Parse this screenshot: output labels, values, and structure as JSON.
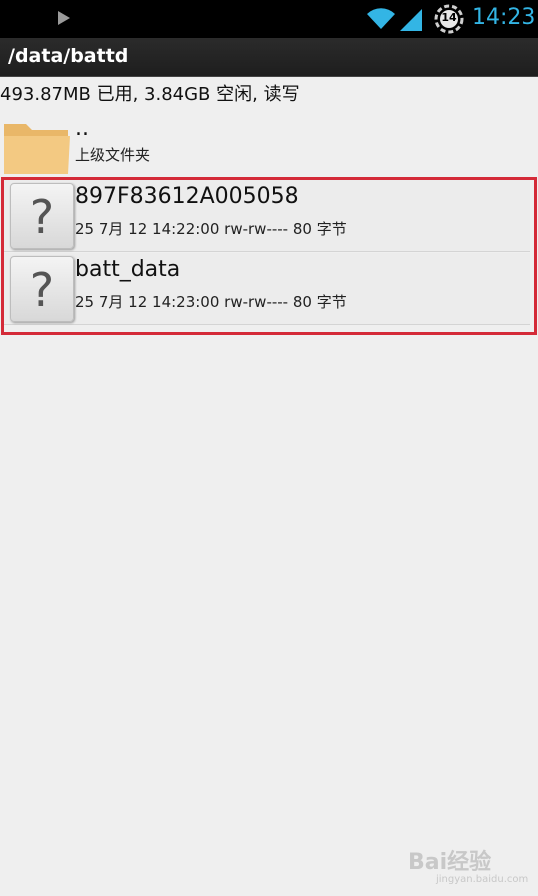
{
  "status_bar": {
    "time": "14:23",
    "notification_count": "14",
    "icons": [
      "play-icon",
      "wifi-icon",
      "signal-icon",
      "sync-badge-icon"
    ]
  },
  "toolbar": {
    "path": "/data/battd"
  },
  "storage_info": "493.87MB 已用, 3.84GB 空闲, 读写",
  "parent_dir": {
    "name": "..",
    "label": "上级文件夹",
    "icon": "folder-icon"
  },
  "files": [
    {
      "name": "897F83612A005058",
      "meta": "25 7月 12 14:22:00  rw-rw----  80 字节",
      "icon": "unknown-file-icon"
    },
    {
      "name": "batt_data",
      "meta": "25 7月 12 14:23:00  rw-rw----  80 字节",
      "icon": "unknown-file-icon"
    }
  ],
  "watermark": {
    "text": "Bai经验",
    "sub": "jingyan.baidu.com"
  },
  "colors": {
    "clock": "#33b5e5",
    "highlight": "#d42a38",
    "background": "#efefef"
  }
}
